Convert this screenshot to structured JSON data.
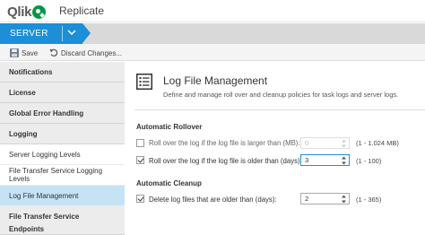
{
  "header": {
    "logo_text": "Qlik",
    "app_name": "Replicate"
  },
  "nav": {
    "server_label": "SERVER"
  },
  "toolbar": {
    "save_label": "Save",
    "discard_label": "Discard Changes..."
  },
  "sidebar": {
    "items": [
      {
        "label": "Notifications"
      },
      {
        "label": "License"
      },
      {
        "label": "Global Error Handling"
      },
      {
        "label": "Logging"
      },
      {
        "label": "Server Logging Levels"
      },
      {
        "label": "File Transfer Service Logging Levels"
      },
      {
        "label": "Log File Management"
      },
      {
        "label": "File Transfer Service"
      },
      {
        "label": "Endpoints"
      }
    ]
  },
  "main": {
    "title": "Log File Management",
    "description": "Define and manage roll over and cleanup policies for task logs and server logs.",
    "rollover": {
      "section_label": "Automatic Rollover",
      "size": {
        "label": "Roll over the log if the log file is larger than (MB):",
        "value": "0",
        "range": "(1 - 1.024 MB)",
        "checked": false
      },
      "age": {
        "label": "Roll over the log if the log file is older than (days):",
        "value": "3",
        "range": "(1 - 100)",
        "checked": true
      }
    },
    "cleanup": {
      "section_label": "Automatic Cleanup",
      "delete": {
        "label": "Delete log files that are older than (days):",
        "value": "2",
        "range": "(1 - 365)",
        "checked": true
      }
    }
  },
  "colors": {
    "accent": "#1c8fd6",
    "active_item": "#c6e3f5",
    "logo_green": "#009845"
  }
}
